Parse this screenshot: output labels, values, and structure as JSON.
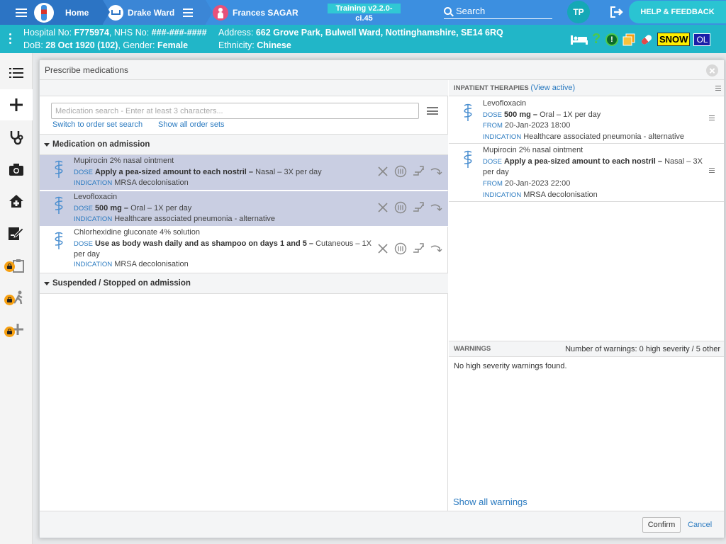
{
  "topbar": {
    "home_label": "Home",
    "ward_label": "Drake Ward",
    "patient_label": "Frances SAGAR",
    "training_label": "Training v2.2.0-ci.45",
    "search_label": "Search",
    "avatar_initials": "TP",
    "help_label": "HELP & FEEDBACK"
  },
  "banner": {
    "hospital_prefix": "Hospital No: ",
    "hospital_no": "F775974",
    "nhs_prefix": ", NHS No: ",
    "nhs_no": "###-###-####",
    "dob_prefix": "DoB: ",
    "dob": "28 Oct 1920 (102)",
    "gender_prefix": ", Gender: ",
    "gender": "Female",
    "address_prefix": "Address: ",
    "address": "662 Grove Park, Bulwell Ward, Nottinghamshire, SE14 6RQ",
    "ethnicity_prefix": "Ethnicity: ",
    "ethnicity": "Chinese",
    "snow_label": "SNOW",
    "ol_label": "OL",
    "q_label": "?",
    "excl_label": "!"
  },
  "modal": {
    "title": "Prescribe medications",
    "search_placeholder": "Medication search - Enter at least 3 characters...",
    "switch_link": "Switch to order set search",
    "show_all_link": "Show all order sets",
    "section_admission": "Medication on admission",
    "section_suspended": "Suspended / Stopped on admission",
    "dose_label": "DOSE",
    "indication_label": "INDICATION",
    "from_label": "FROM",
    "admission_meds": [
      {
        "name": "Mupirocin 2% nasal ointment",
        "dose_bold": "Apply a pea-sized amount to each nostril –",
        "dose_rest": " Nasal – 3X per day",
        "indication": "MRSA decolonisation"
      },
      {
        "name": "Levofloxacin",
        "dose_bold": "500 mg –",
        "dose_rest": " Oral – 1X per day",
        "indication": "Healthcare associated pneumonia - alternative"
      },
      {
        "name": "Chlorhexidine gluconate 4% solution",
        "dose_bold": "Use as body wash daily and as shampoo on days 1 and 5 –",
        "dose_rest": " Cutaneous – 1X per day",
        "indication": "MRSA decolonisation"
      }
    ],
    "inpatient_title": "INPATIENT THERAPIES",
    "view_active_link": "View active",
    "inpatient": [
      {
        "name": "Levofloxacin",
        "dose_bold": "500 mg –",
        "dose_rest": " Oral – 1X per day",
        "from": "20-Jan-2023 18:00",
        "indication": "Healthcare associated pneumonia - alternative"
      },
      {
        "name": "Mupirocin 2% nasal ointment",
        "dose_bold": "Apply a pea-sized amount to each nostril –",
        "dose_rest": " Nasal – 3X per day",
        "from": "20-Jan-2023 22:00",
        "indication": "MRSA decolonisation"
      }
    ],
    "warnings_title": "WARNINGS",
    "warnings_count": "Number of warnings: 0 high severity / 5 other",
    "no_warnings": "No high severity warnings found.",
    "show_warnings_link": "Show all warnings",
    "confirm_label": "Confirm",
    "cancel_label": "Cancel"
  },
  "colors": {
    "topbar": "#3c8fe0",
    "banner": "#21b6c8",
    "selected_row": "#c9cee2",
    "link": "#2a7ac0"
  }
}
